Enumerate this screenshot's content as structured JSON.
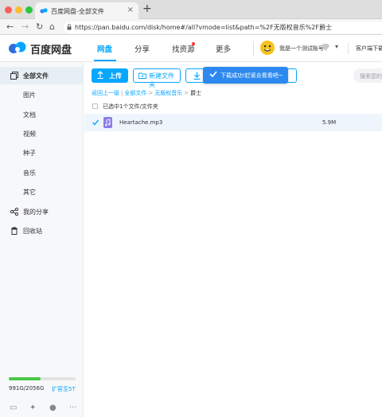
{
  "browser": {
    "tab_title": "百度网盘-全部文件",
    "url": "https://pan.baidu.com/disk/home#/all?vmode=list&path=%2F无版权音乐%2F爵士"
  },
  "header": {
    "logo_text": "百度网盘",
    "nav": [
      "网盘",
      "分享",
      "找资源",
      "更多"
    ],
    "username": "我是一个测试账号",
    "client_download": "客户端下载"
  },
  "sidebar": {
    "items": [
      "全部文件",
      "图片",
      "文档",
      "视频",
      "种子",
      "音乐",
      "其它",
      "我的分享",
      "回收站"
    ],
    "quota_text": "991G/2056G",
    "quota_fraction": 0.48,
    "expand_label": "扩容至5T"
  },
  "toolbar": {
    "upload_label": "上传",
    "new_folder_label": "新建文件夹",
    "toast_text": "下载成功!赶紧去看看吧~",
    "search_placeholder": "搜索您的文件"
  },
  "breadcrumb": {
    "back": "返回上一级",
    "all": "全部文件",
    "folder": "无版权音乐",
    "current": "爵士"
  },
  "selection_text": "已选中1个文件/文件夹",
  "files": [
    {
      "name": "Heartache.mp3",
      "size": "5.9M"
    }
  ],
  "colors": {
    "accent": "#06a7ff",
    "toast": "#2d89f0",
    "quota": "#4ac84a"
  }
}
